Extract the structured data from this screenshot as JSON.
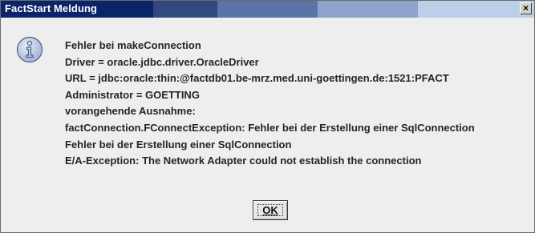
{
  "window": {
    "title": "FactStart Meldung",
    "close_glyph": "×"
  },
  "icon": {
    "name": "info-icon"
  },
  "messages": [
    "Fehler bei makeConnection",
    "Driver = oracle.jdbc.driver.OracleDriver",
    "URL = jdbc:oracle:thin:@factdb01.be-mrz.med.uni-goettingen.de:1521:PFACT",
    "Administrator = GOETTING",
    "vorangehende Ausnahme:",
    "factConnection.FConnectException: Fehler bei der Erstellung einer SqlConnection",
    "Fehler bei der Erstellung einer SqlConnection",
    "E/A-Exception: The Network Adapter could not establish the connection"
  ],
  "buttons": {
    "ok_label": "OK"
  },
  "colors": {
    "titlebar_dark": "#0a246a",
    "titlebar_light": "#bccfe8",
    "dialog_bg": "#eeeeee",
    "text": "#252525"
  }
}
